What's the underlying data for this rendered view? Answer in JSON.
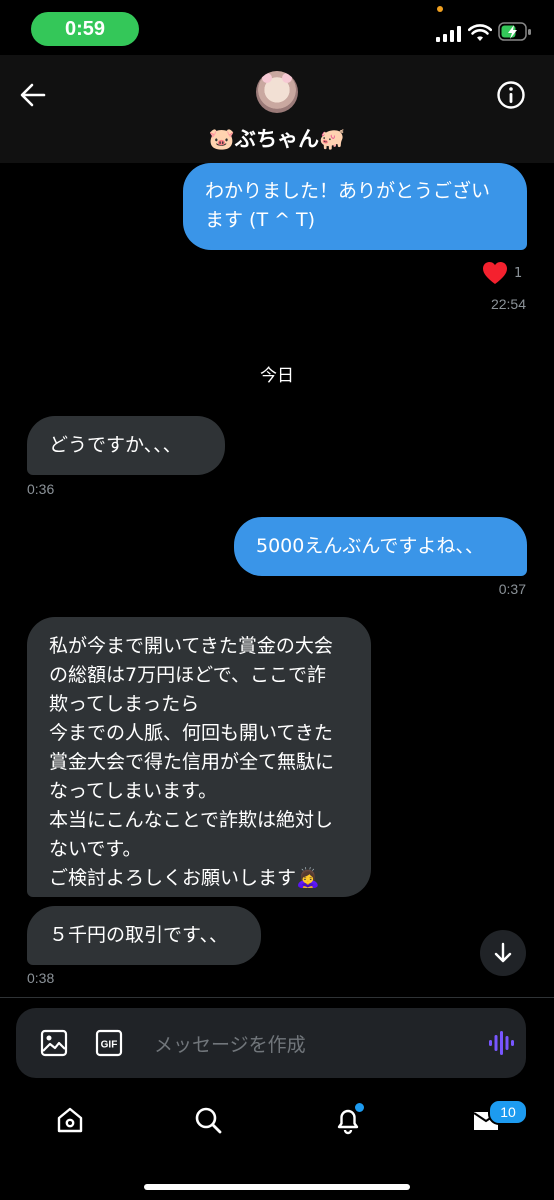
{
  "status_bar": {
    "time": "0:59"
  },
  "header": {
    "display_name": "🐷ぶちゃん🐖"
  },
  "messages": [
    {
      "direction": "out",
      "text": "わかりました！ありがとうござい\nます (T ^ T)",
      "reaction_count": "1",
      "time": "22:54"
    },
    {
      "direction": "in",
      "text": "どうですか、、、",
      "time": "0:36"
    },
    {
      "direction": "out",
      "text": "5000えんぶんですよね、、",
      "time": "0:37"
    },
    {
      "direction": "in",
      "text": "私が今まで開いてきた賞金の大会\nの総額は7万円ほどで、ここで詐\n欺ってしまったら\n今までの人脈、何回も開いてきた\n賞金大会で得た信用が全て無駄に\nなってしまいます。\n本当にこんなことで詐欺は絶対し\nないです。\nご検討よろしくお願いします🙇‍♀️"
    },
    {
      "direction": "in",
      "text": "５千円の取引です、、",
      "time": "0:38"
    }
  ],
  "date_separator": "今日",
  "composer": {
    "placeholder": "メッセージを作成"
  },
  "tab_bar": {
    "messages_badge": "10"
  },
  "colors": {
    "outgoing": "#3a95e8",
    "incoming": "#2f3336",
    "accent": "#1d9bf0",
    "time_pill": "#34c759"
  }
}
